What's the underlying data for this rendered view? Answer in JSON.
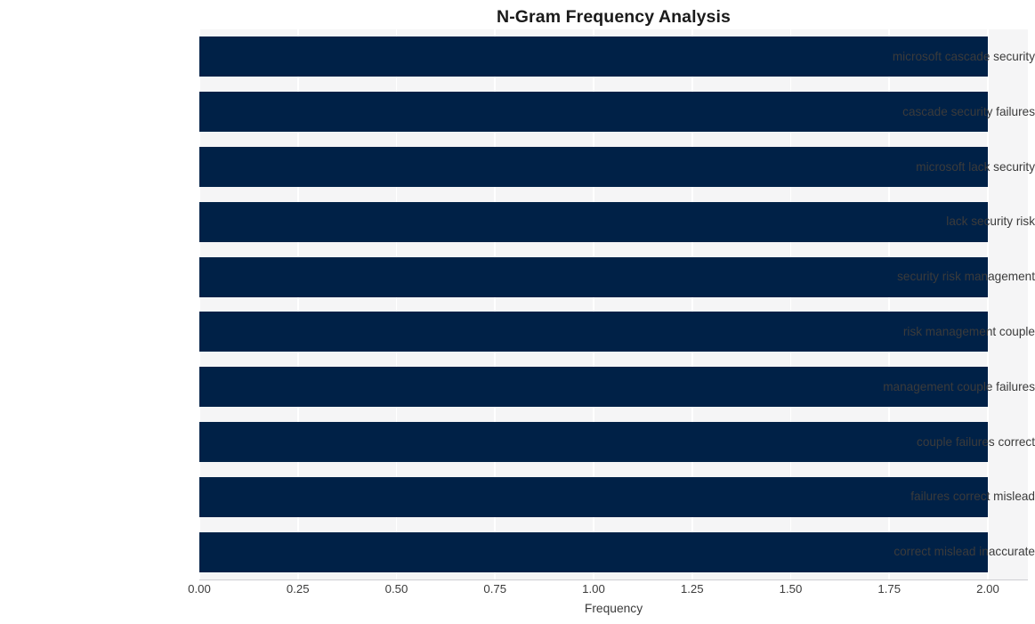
{
  "chart_data": {
    "type": "bar",
    "orientation": "horizontal",
    "title": "N-Gram Frequency Analysis",
    "xlabel": "Frequency",
    "ylabel": "",
    "xlim": [
      0.0,
      2.0
    ],
    "xticks": [
      "0.00",
      "0.25",
      "0.50",
      "0.75",
      "1.00",
      "1.25",
      "1.50",
      "1.75",
      "2.00"
    ],
    "xtick_values": [
      0.0,
      0.25,
      0.5,
      0.75,
      1.0,
      1.25,
      1.5,
      1.75,
      2.0
    ],
    "grid": "vertical",
    "legend": "none",
    "bar_color": "#002147",
    "plot_background": "#f5f5f6",
    "gridline_color": "#ffffff",
    "categories": [
      "microsoft cascade security",
      "cascade security failures",
      "microsoft lack security",
      "lack security risk",
      "security risk management",
      "risk management couple",
      "management couple failures",
      "couple failures correct",
      "failures correct mislead",
      "correct mislead inaccurate"
    ],
    "values": [
      2,
      2,
      2,
      2,
      2,
      2,
      2,
      2,
      2,
      2
    ],
    "bars": [
      {
        "label": "microsoft cascade security",
        "value": 2
      },
      {
        "label": "cascade security failures",
        "value": 2
      },
      {
        "label": "microsoft lack security",
        "value": 2
      },
      {
        "label": "lack security risk",
        "value": 2
      },
      {
        "label": "security risk management",
        "value": 2
      },
      {
        "label": "risk management couple",
        "value": 2
      },
      {
        "label": "management couple failures",
        "value": 2
      },
      {
        "label": "couple failures correct",
        "value": 2
      },
      {
        "label": "failures correct mislead",
        "value": 2
      },
      {
        "label": "correct mislead inaccurate",
        "value": 2
      }
    ]
  }
}
